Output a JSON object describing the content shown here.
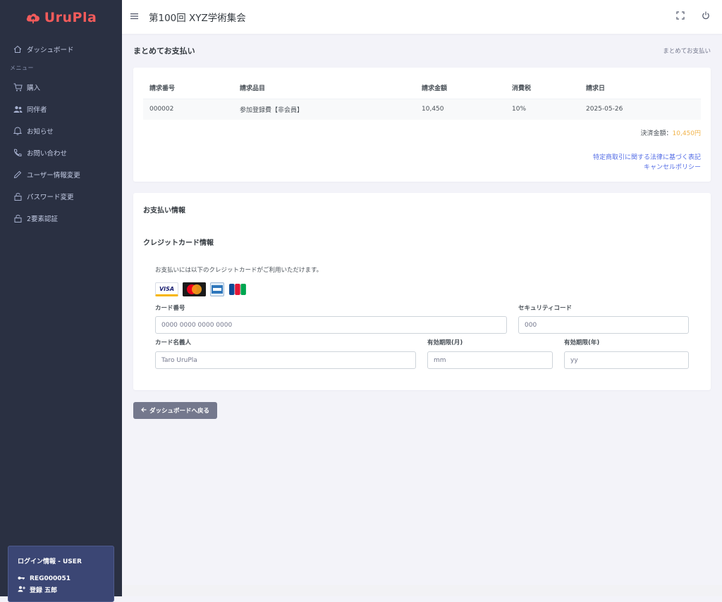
{
  "app": {
    "logo_text": "UruPla",
    "brand_color": "#f35b5b"
  },
  "sidebar": {
    "dashboard": "ダッシュボード",
    "menu_label": "メニュー",
    "items": [
      {
        "label": "購入",
        "icon": "cart-icon"
      },
      {
        "label": "同伴者",
        "icon": "users-icon"
      },
      {
        "label": "お知らせ",
        "icon": "bell-icon"
      },
      {
        "label": "お問い合わせ",
        "icon": "phone-icon"
      },
      {
        "label": "ユーザー情報変更",
        "icon": "pencil-icon"
      },
      {
        "label": "パスワード変更",
        "icon": "lock-icon"
      },
      {
        "label": "2要素認証",
        "icon": "lock-icon"
      }
    ]
  },
  "login": {
    "title": "ログイン情報 - USER",
    "reg_id": "REG000051",
    "name": "登録 五郎"
  },
  "header": {
    "title": "第100回 XYZ学術集会"
  },
  "page": {
    "title": "まとめてお支払い",
    "breadcrumb": "まとめてお支払い"
  },
  "invoice": {
    "columns": [
      "請求番号",
      "請求品目",
      "請求金額",
      "消費税",
      "請求日"
    ],
    "rows": [
      [
        "000002",
        "参加登録費【非会員】",
        "10,450",
        "10%",
        "2025-05-26"
      ]
    ],
    "total_label": "決済金額：",
    "total_value": "10,450円",
    "link_law": "特定商取引に関する法律に基づく表記",
    "link_cancel": "キャンセルポリシー"
  },
  "payment": {
    "section_title": "お支払い情報",
    "cc_title": "クレジットカード情報",
    "note": "お支払いには以下のクレジットカードがご利用いただけます。",
    "brands": [
      "VISA",
      "MasterCard",
      "AMEX",
      "JCB"
    ],
    "card_number_label": "カード番号",
    "card_number_placeholder": "0000 0000 0000 0000",
    "security_label": "セキュリティコード",
    "security_placeholder": "000",
    "holder_label": "カード名義人",
    "holder_placeholder": "Taro UruPla",
    "month_label": "有効期限(月)",
    "month_placeholder": "mm",
    "year_label": "有効期限(年)",
    "year_placeholder": "yy"
  },
  "back_button": "ダッシュボードへ戻る"
}
